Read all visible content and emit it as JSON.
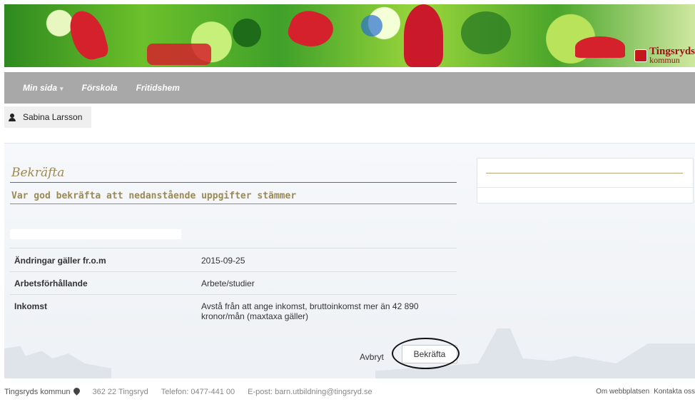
{
  "header": {
    "logo_line1": "Tingsryds",
    "logo_line2": "kommun"
  },
  "nav": {
    "items": [
      {
        "label": "Min sida",
        "has_caret": true
      },
      {
        "label": "Förskola"
      },
      {
        "label": "Fritidshem"
      }
    ],
    "caret": "▾"
  },
  "user": {
    "name": "Sabina Larsson",
    "icon": "user-icon"
  },
  "form": {
    "title": "Bekräfta",
    "subtitle": "Var god bekräfta att nedanstående uppgifter stämmer",
    "rows": [
      {
        "label": "Ändringar gäller fr.o.m",
        "value": "2015-09-25"
      },
      {
        "label": "Arbetsförhållande",
        "value": "Arbete/studier"
      },
      {
        "label": "Inkomst",
        "value": "Avstå från att ange inkomst, bruttoinkomst mer än 42 890 kronor/mån (maxtaxa gäller)"
      }
    ],
    "cancel_label": "Avbryt",
    "confirm_label": "Bekräfta"
  },
  "footer": {
    "org": "Tingsryds kommun",
    "address": "362 22 Tingsryd",
    "phone": "Telefon: 0477-441 00",
    "email": "E-post: barn.utbildning@tingsryd.se",
    "link_about": "Om webbplatsen",
    "link_contact": "Kontakta oss"
  },
  "colors": {
    "nav_bg": "#a8a8a8",
    "title_color": "#9b8a52",
    "brand_red": "#c4161c"
  }
}
